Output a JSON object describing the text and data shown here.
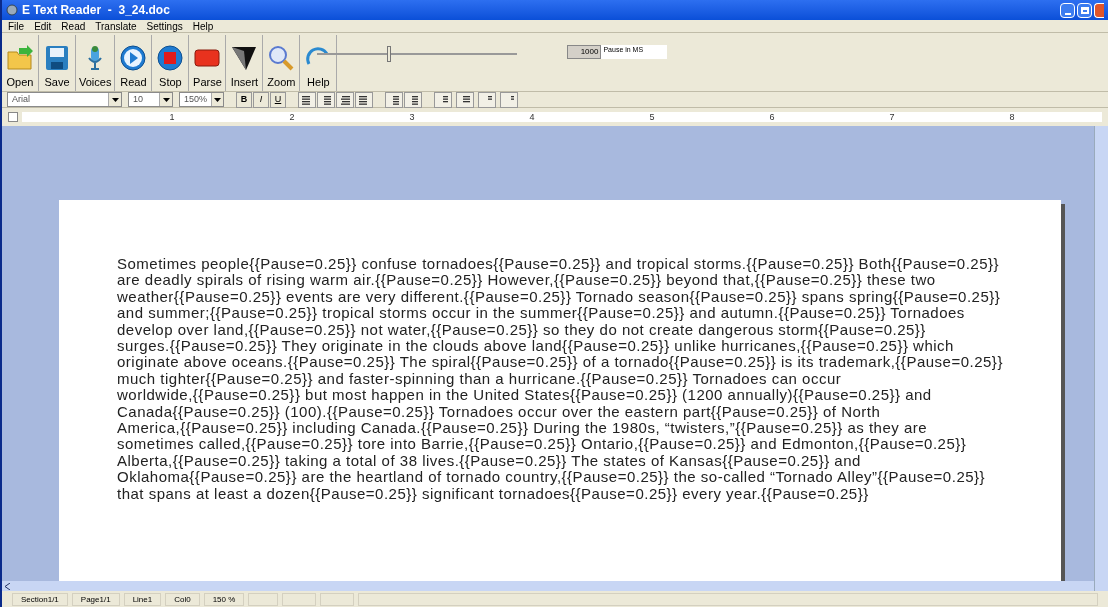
{
  "window": {
    "title": "E Text Reader  -  3_24.doc"
  },
  "menu": [
    "File",
    "Edit",
    "Read",
    "Translate",
    "Settings",
    "Help"
  ],
  "toolbar": [
    {
      "kind": "open",
      "label": "Open"
    },
    {
      "kind": "save",
      "label": "Save"
    },
    {
      "kind": "voices",
      "label": "Voices"
    },
    {
      "kind": "read",
      "label": "Read"
    },
    {
      "kind": "stop",
      "label": "Stop"
    },
    {
      "kind": "parse",
      "label": "Parse"
    },
    {
      "kind": "insert",
      "label": "Insert"
    },
    {
      "kind": "zoom",
      "label": "Zoom"
    },
    {
      "kind": "help",
      "label": "Help"
    }
  ],
  "speed_slider": {
    "level": 0.35
  },
  "pause": {
    "value": "1000",
    "label": "Pause in MS"
  },
  "format_bar": {
    "font": "Arial",
    "size": "10",
    "zoom": "150%",
    "style_buttons": [
      "B",
      "I",
      "U"
    ]
  },
  "ruler": {
    "labels": [
      "1",
      "2",
      "3",
      "4",
      "5",
      "6",
      "7",
      "8"
    ]
  },
  "document": {
    "lines": [
      "Sometimes people{{Pause=0.25}} confuse tornadoes{{Pause=0.25}} and tropical storms.{{Pause=0.25}} Both{{Pause=0.25}}",
      "are deadly spirals of rising warm air.{{Pause=0.25}} However,{{Pause=0.25}} beyond that,{{Pause=0.25}} these two",
      "weather{{Pause=0.25}} events are very different.{{Pause=0.25}} Tornado season{{Pause=0.25}} spans spring{{Pause=0.25}}",
      "and summer;{{Pause=0.25}} tropical storms occur in the summer{{Pause=0.25}} and autumn.{{Pause=0.25}} Tornadoes",
      "develop over land,{{Pause=0.25}} not water,{{Pause=0.25}} so they do not create dangerous storm{{Pause=0.25}}",
      "surges.{{Pause=0.25}} They originate in the clouds above land{{Pause=0.25}} unlike hurricanes,{{Pause=0.25}} which",
      "originate above oceans.{{Pause=0.25}} The spiral{{Pause=0.25}} of a tornado{{Pause=0.25}} is its trademark,{{Pause=0.25}}",
      "much tighter{{Pause=0.25}} and faster-spinning than a hurricane.{{Pause=0.25}} Tornadoes can occur",
      "worldwide,{{Pause=0.25}} but most happen in the United States{{Pause=0.25}} (1200 annually){{Pause=0.25}} and",
      "Canada{{Pause=0.25}} (100).{{Pause=0.25}} Tornadoes occur over the eastern part{{Pause=0.25}} of North",
      "America,{{Pause=0.25}} including Canada.{{Pause=0.25}} During the 1980s, “twisters,”{{Pause=0.25}} as they are",
      "sometimes called,{{Pause=0.25}} tore into Barrie,{{Pause=0.25}} Ontario,{{Pause=0.25}} and Edmonton,{{Pause=0.25}}",
      "Alberta,{{Pause=0.25}} taking a total of 38 lives.{{Pause=0.25}} The states of Kansas{{Pause=0.25}} and",
      "Oklahoma{{Pause=0.25}} are the heartland of tornado country,{{Pause=0.25}} the so-called “Tornado Alley”{{Pause=0.25}}",
      "that spans at least a dozen{{Pause=0.25}} significant tornadoes{{Pause=0.25}} every year.{{Pause=0.25}}"
    ]
  },
  "status_bar": [
    "Section1/1",
    "Page1/1",
    "Line1",
    "Col0",
    "150 %"
  ]
}
